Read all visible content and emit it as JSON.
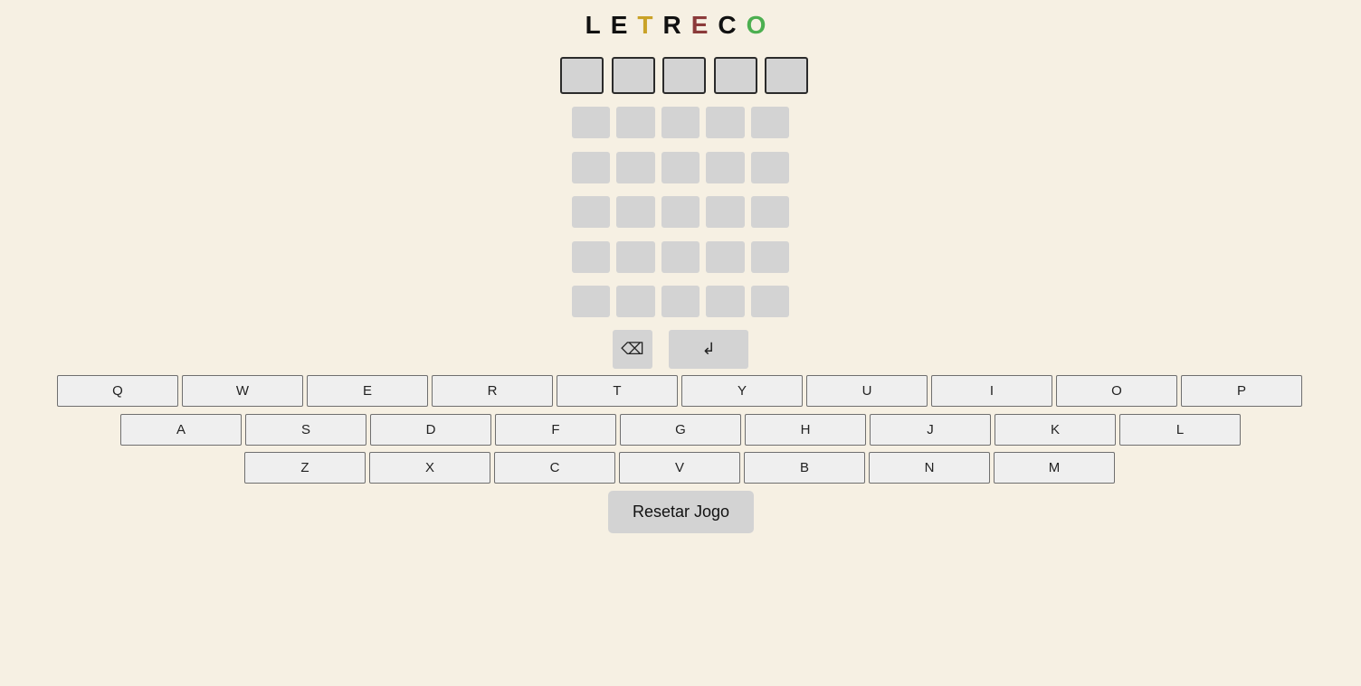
{
  "title": {
    "letters": [
      {
        "char": "L",
        "color": "#111111"
      },
      {
        "char": "E",
        "color": "#111111"
      },
      {
        "char": "T",
        "color": "#c9a227"
      },
      {
        "char": "R",
        "color": "#111111"
      },
      {
        "char": "E",
        "color": "#8b3a3a"
      },
      {
        "char": "C",
        "color": "#111111"
      },
      {
        "char": "O",
        "color": "#4caf50"
      }
    ]
  },
  "board": {
    "active_row": [
      "",
      "",
      "",
      "",
      ""
    ],
    "rows": [
      [
        "",
        "",
        "",
        "",
        ""
      ],
      [
        "",
        "",
        "",
        "",
        ""
      ],
      [
        "",
        "",
        "",
        "",
        ""
      ],
      [
        "",
        "",
        "",
        "",
        ""
      ],
      [
        "",
        "",
        "",
        "",
        ""
      ]
    ]
  },
  "controls": {
    "backspace_icon": "⌫",
    "enter_icon": "↲"
  },
  "keyboard": {
    "row1": [
      "Q",
      "W",
      "E",
      "R",
      "T",
      "Y",
      "U",
      "I",
      "O",
      "P"
    ],
    "row2": [
      "A",
      "S",
      "D",
      "F",
      "G",
      "H",
      "J",
      "K",
      "L"
    ],
    "row3": [
      "Z",
      "X",
      "C",
      "V",
      "B",
      "N",
      "M"
    ]
  },
  "reset_label": "Resetar Jogo"
}
